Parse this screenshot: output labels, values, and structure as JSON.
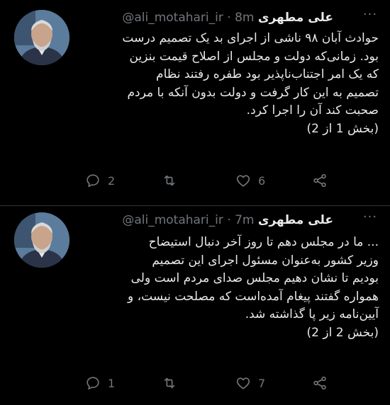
{
  "tweets": [
    {
      "name": "علی مطهری",
      "handle": "@ali_motahari_ir",
      "time": "· 8m",
      "lines": [
        "حوادث آبان ۹۸ ناشی از اجرای بد یک تصمیم درست",
        "بود. زمانی‌که دولت و مجلس از اصلاح قیمت بنزین",
        "که یک امر اجتناب‌ناپذیر بود طفره رفتند نظام",
        "تصمیم به این کار گرفت و دولت بدون آنکه با مردم",
        "صحبت کند آن را اجرا کرد.",
        "(بخش 1 از 2)"
      ],
      "replies": "2",
      "retweets": "",
      "likes": "6"
    },
    {
      "name": "علی مطهری",
      "handle": "@ali_motahari_ir",
      "time": "· 7m",
      "lines": [
        "... ما در مجلس دهم تا روز آخر دنبال استیضاح",
        "وزیر کشور به‌عنوان مسئول اجرای این تصمیم",
        "بودیم تا نشان دهیم مجلس صدای مردم است ولی",
        "همواره گفتند پیغام آمده‌است که مصلحت نیست، و",
        "آیین‌نامه زیر پا گذاشته شد.",
        "(بخش 2 از 2)"
      ],
      "replies": "1",
      "retweets": "",
      "likes": "7"
    }
  ],
  "icons": {
    "reply": "reply-icon",
    "retweet": "retweet-icon",
    "like": "heart-icon",
    "share": "share-icon",
    "more": "more-options-icon"
  },
  "colors": {
    "background": "#000000",
    "text": "#e7e9ea",
    "secondary": "#71767b",
    "divider": "#2f3336"
  }
}
